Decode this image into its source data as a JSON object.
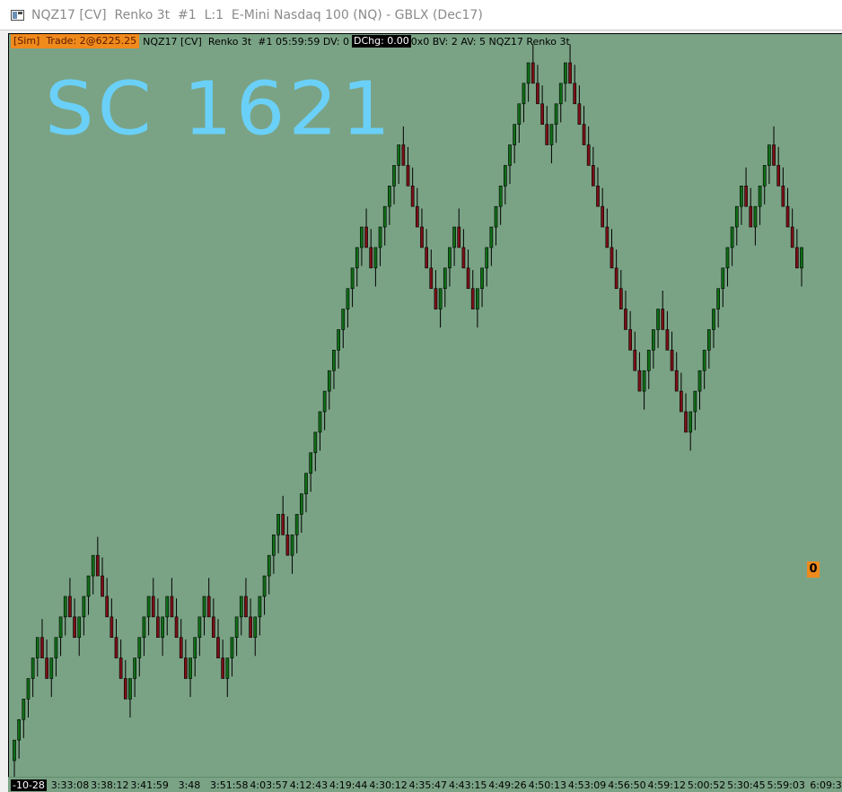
{
  "window": {
    "title": "NQZ17 [CV]  Renko 3t  #1  L:1  E-Mini Nasdaq 100 (NQ) - GBLX (Dec17)"
  },
  "infobar": {
    "sim_trade": "[Sim]  Trade: 2@6225.25",
    "symbol_text": "NQZ17 [CV]  Renko 3t  #1 05:59:59 DV: 0",
    "dchg": "DChg: 0.00",
    "stats": "0x0 BV: 2 AV: 5 NQZ17 Renko 3t"
  },
  "annotation": {
    "handwriting": "SC 1621"
  },
  "position_badge": "0",
  "timebar": {
    "first_date": "-10-28",
    "labels": [
      "3:33:08",
      "3:38:12",
      "3:41:59",
      "3:48",
      "3:51:58",
      "4:03:57",
      "4:12:43",
      "4:19:44",
      "4:30:12",
      "4:35:47",
      "4:43:15",
      "4:49:26",
      "4:50:13",
      "4:53:09",
      "4:56:50",
      "4:59:12",
      "5:00:52",
      "5:30:45",
      "5:59:03",
      "6:09:3"
    ]
  },
  "colors": {
    "background": "#7aa385",
    "up_bar": "#0f6e16",
    "down_bar": "#7a1016",
    "wick": "#000000",
    "handwriting": "#6ad0f8",
    "badge": "#f08a1c"
  },
  "chart_data": {
    "type": "candlestick",
    "series_type": "renko",
    "brick_size_ticks": 3,
    "price_units": "bricks (relative)",
    "brick_directions": [
      "up",
      "up",
      "up",
      "up",
      "up",
      "up",
      "down",
      "down",
      "up",
      "up",
      "up",
      "up",
      "down",
      "down",
      "up",
      "up",
      "up",
      "up",
      "down",
      "down",
      "down",
      "down",
      "down",
      "down",
      "down",
      "up",
      "up",
      "up",
      "up",
      "up",
      "down",
      "down",
      "up",
      "up",
      "down",
      "down",
      "down",
      "down",
      "up",
      "up",
      "up",
      "up",
      "down",
      "down",
      "down",
      "down",
      "up",
      "up",
      "up",
      "up",
      "down",
      "down",
      "up",
      "up",
      "up",
      "up",
      "up",
      "up",
      "down",
      "down",
      "up",
      "up",
      "up",
      "up",
      "up",
      "up",
      "up",
      "up",
      "up",
      "up",
      "up",
      "up",
      "up",
      "up",
      "up",
      "up",
      "down",
      "down",
      "up",
      "up",
      "up",
      "up",
      "up",
      "up",
      "down",
      "down",
      "down",
      "down",
      "down",
      "down",
      "down",
      "down",
      "up",
      "up",
      "up",
      "up",
      "down",
      "down",
      "down",
      "down",
      "up",
      "up",
      "up",
      "up",
      "up",
      "up",
      "up",
      "up",
      "up",
      "up",
      "up",
      "up",
      "down",
      "down",
      "down",
      "down",
      "up",
      "up",
      "up",
      "up",
      "down",
      "down",
      "down",
      "down",
      "down",
      "down",
      "down",
      "down",
      "down",
      "down",
      "down",
      "down",
      "down",
      "down",
      "down",
      "down",
      "up",
      "up",
      "up",
      "up",
      "down",
      "down",
      "down",
      "down",
      "down",
      "down",
      "up",
      "up",
      "up",
      "up",
      "up",
      "up",
      "up",
      "up",
      "up",
      "up",
      "up",
      "up",
      "down",
      "down",
      "up",
      "up",
      "up",
      "up",
      "down",
      "down",
      "down",
      "down",
      "down",
      "down",
      "up"
    ],
    "note_x": "bars are equally spaced brick indices; time axis labels shown below"
  }
}
